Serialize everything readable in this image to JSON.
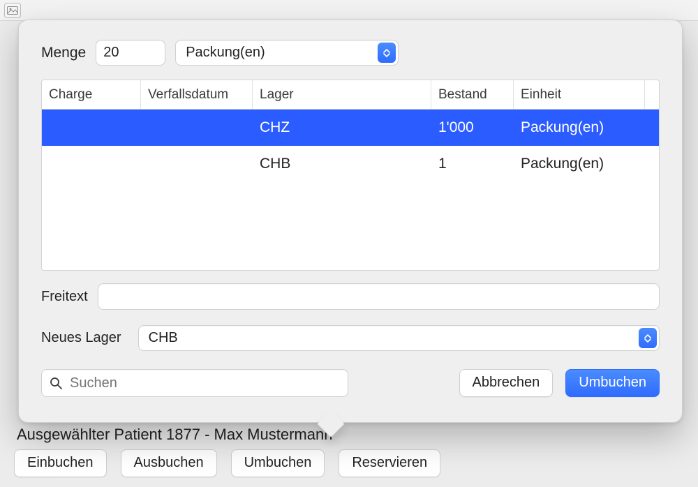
{
  "header": {
    "icon": "image-icon"
  },
  "form": {
    "menge_label": "Menge",
    "menge_value": "20",
    "einheit_selected": "Packung(en)"
  },
  "table": {
    "headers": {
      "charge": "Charge",
      "verfallsdatum": "Verfallsdatum",
      "lager": "Lager",
      "bestand": "Bestand",
      "einheit": "Einheit"
    },
    "rows": [
      {
        "charge": "",
        "verfallsdatum": "",
        "lager": "CHZ",
        "bestand": "1'000",
        "einheit": "Packung(en)",
        "selected": true
      },
      {
        "charge": "",
        "verfallsdatum": "",
        "lager": "CHB",
        "bestand": "1",
        "einheit": "Packung(en)",
        "selected": false
      }
    ]
  },
  "freitext": {
    "label": "Freitext",
    "value": ""
  },
  "neues_lager": {
    "label": "Neues Lager",
    "selected": "CHB"
  },
  "search": {
    "placeholder": "Suchen"
  },
  "buttons": {
    "abbrechen": "Abbrechen",
    "umbuchen": "Umbuchen"
  },
  "background": {
    "patient_label": "Ausgewählter Patient 1877 - Max Mustermann",
    "buttons": {
      "einbuchen": "Einbuchen",
      "ausbuchen": "Ausbuchen",
      "umbuchen": "Umbuchen",
      "reservieren": "Reservieren"
    }
  }
}
